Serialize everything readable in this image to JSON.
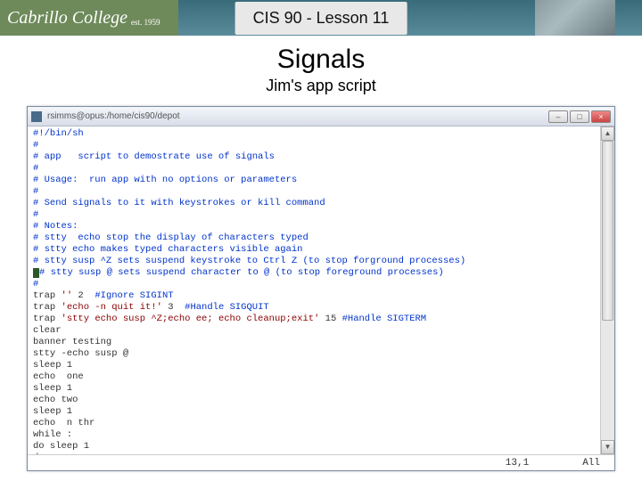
{
  "header": {
    "logo_text": "Cabrillo College",
    "logo_year": "est. 1959",
    "lesson": "CIS 90 - Lesson 11"
  },
  "titles": {
    "main": "Signals",
    "sub": "Jim's app script"
  },
  "window": {
    "path": "rsimms@opus:/home/cis90/depot",
    "min": "–",
    "max": "□",
    "close": "×"
  },
  "code": {
    "lines": [
      "#!/bin/sh",
      "#",
      "# app   script to demostrate use of signals",
      "#",
      "# Usage:  run app with no options or parameters",
      "#",
      "# Send signals to it with keystrokes or kill command",
      "#",
      "# Notes:",
      "# stty  echo stop the display of characters typed",
      "# stty echo makes typed characters visible again",
      "# stty susp ^Z sets suspend keystroke to Ctrl Z (to stop forground processes)",
      "# stty susp @ sets suspend character to @ (to stop foreground processes)",
      "#",
      "trap '' 2  #Ignore SIGINT",
      "trap 'echo -n quit it!' 3  #Handle SIGQUIT",
      "trap 'stty echo susp ^Z;echo ee; echo cleanup;exit' 15 #Handle SIGTERM",
      "clear",
      "banner testing",
      "stty -echo susp @",
      "sleep 1",
      "echo  one",
      "sleep 1",
      "echo two",
      "sleep 1",
      "echo  n thr",
      "while :",
      "do sleep 1",
      "done"
    ]
  },
  "status": {
    "pos": "13,1",
    "scroll": "All"
  }
}
